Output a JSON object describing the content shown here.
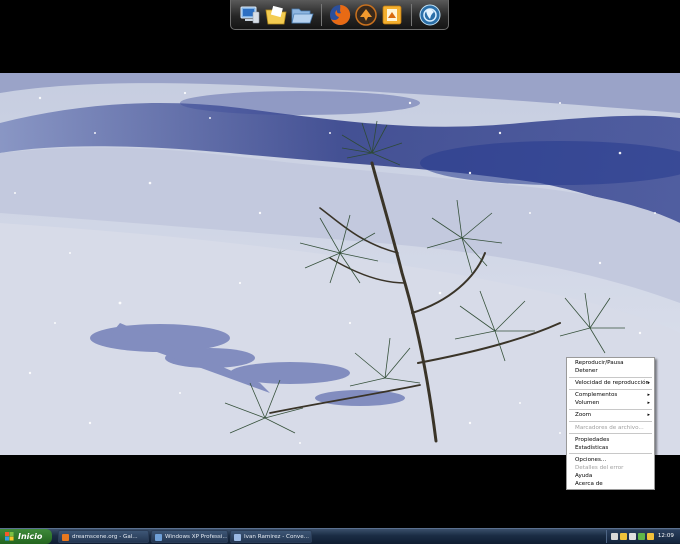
{
  "dock": {
    "icons": [
      "computer-icon",
      "folder-documents-icon",
      "folder-open-icon",
      "firefox-icon",
      "winamp-icon",
      "office-icon",
      "dreamscene-icon"
    ]
  },
  "context_menu": {
    "items": [
      {
        "label": "Reproducir/Pausa",
        "enabled": true,
        "submenu": false
      },
      {
        "label": "Detener",
        "enabled": true,
        "submenu": false
      },
      {
        "label": "Velocidad de reproducción",
        "enabled": true,
        "submenu": true
      },
      {
        "label": "Complementos",
        "enabled": true,
        "submenu": true
      },
      {
        "label": "Volumen",
        "enabled": true,
        "submenu": true
      },
      {
        "label": "Zoom",
        "enabled": true,
        "submenu": true
      },
      {
        "label": "Marcadores de archivo...",
        "enabled": false,
        "submenu": false
      },
      {
        "label": "Propiedades",
        "enabled": true,
        "submenu": false
      },
      {
        "label": "Estadísticas",
        "enabled": true,
        "submenu": false
      },
      {
        "label": "Opciones...",
        "enabled": true,
        "submenu": false
      },
      {
        "label": "Detalles del error",
        "enabled": false,
        "submenu": false
      },
      {
        "label": "Ayuda",
        "enabled": true,
        "submenu": false
      },
      {
        "label": "Acerca de",
        "enabled": true,
        "submenu": false
      }
    ],
    "arrow": "▸"
  },
  "taskbar": {
    "start_label": "Inicio",
    "tasks": [
      {
        "label": "dreamscene.org - Gal...",
        "icon": "firefox-icon"
      },
      {
        "label": "Windows XP Professi...",
        "icon": "window-icon"
      },
      {
        "label": "Ivan Ramirez - Conve...",
        "icon": "messenger-icon"
      }
    ],
    "clock": "12:09"
  },
  "colors": {
    "accent": "#1f3f8a",
    "snow": "#e6e9f2",
    "taskbar": "#1a2c44",
    "start_green": "#2f7a2b"
  }
}
